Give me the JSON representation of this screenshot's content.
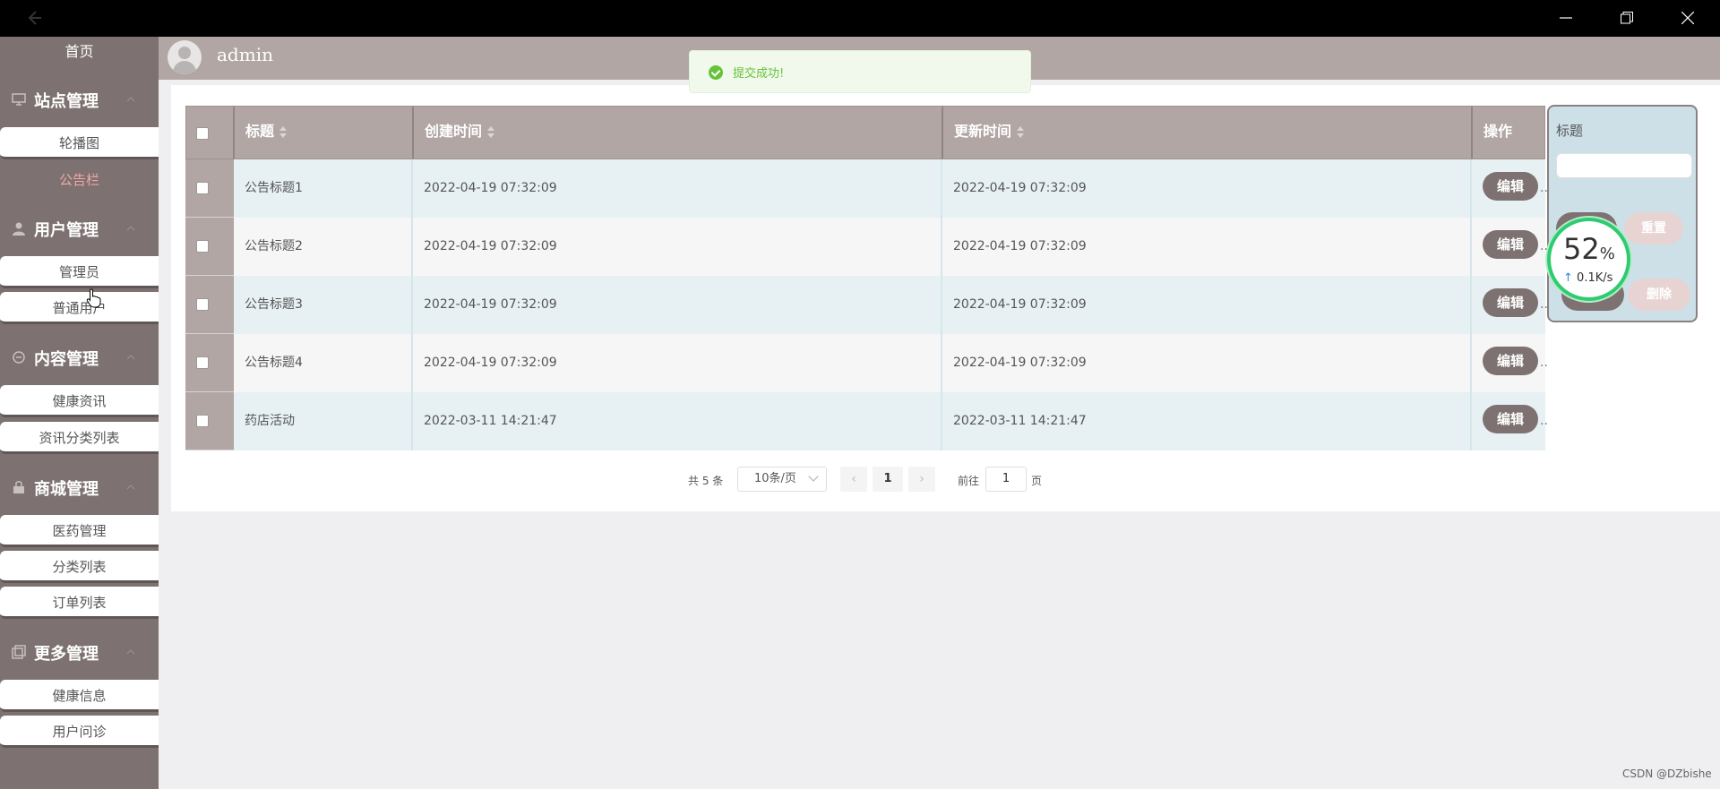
{
  "header": {
    "username": "admin"
  },
  "sidebar": {
    "home": "首页",
    "groups": [
      {
        "label": "站点管理",
        "items": [
          "轮播图",
          "公告栏"
        ]
      },
      {
        "label": "用户管理",
        "items": [
          "管理员",
          "普通用户"
        ]
      },
      {
        "label": "内容管理",
        "items": [
          "健康资讯",
          "资讯分类列表"
        ]
      },
      {
        "label": "商城管理",
        "items": [
          "医药管理",
          "分类列表",
          "订单列表"
        ]
      },
      {
        "label": "更多管理",
        "items": [
          "健康信息",
          "用户问诊"
        ]
      }
    ],
    "active_item": "公告栏"
  },
  "toast": {
    "text": "提交成功!"
  },
  "table": {
    "columns": [
      "标题",
      "创建时间",
      "更新时间",
      "操作"
    ],
    "edit_label": "编辑",
    "rows": [
      {
        "title": "公告标题1",
        "created": "2022-04-19 07:32:09",
        "updated": "2022-04-19 07:32:09"
      },
      {
        "title": "公告标题2",
        "created": "2022-04-19 07:32:09",
        "updated": "2022-04-19 07:32:09"
      },
      {
        "title": "公告标题3",
        "created": "2022-04-19 07:32:09",
        "updated": "2022-04-19 07:32:09"
      },
      {
        "title": "公告标题4",
        "created": "2022-04-19 07:32:09",
        "updated": "2022-04-19 07:32:09"
      },
      {
        "title": "药店活动",
        "created": "2022-03-11 14:21:47",
        "updated": "2022-03-11 14:21:47"
      }
    ]
  },
  "pagination": {
    "total_text": "共 5 条",
    "page_size": "10条/页",
    "current_page": "1",
    "goto_label": "前往",
    "goto_value": "1",
    "page_label": "页"
  },
  "search_panel": {
    "title_label": "标题",
    "reset_label": "重置",
    "delete_label": "删除"
  },
  "network_widget": {
    "percent": "52",
    "percent_unit": "%",
    "speed": "0.1K/s"
  },
  "watermark": "CSDN @DZbishe",
  "colors": {
    "sidebar": "#7d7271",
    "header": "#b1a6a4",
    "accent_active": "#f2a6a6",
    "success": "#67c23a"
  }
}
